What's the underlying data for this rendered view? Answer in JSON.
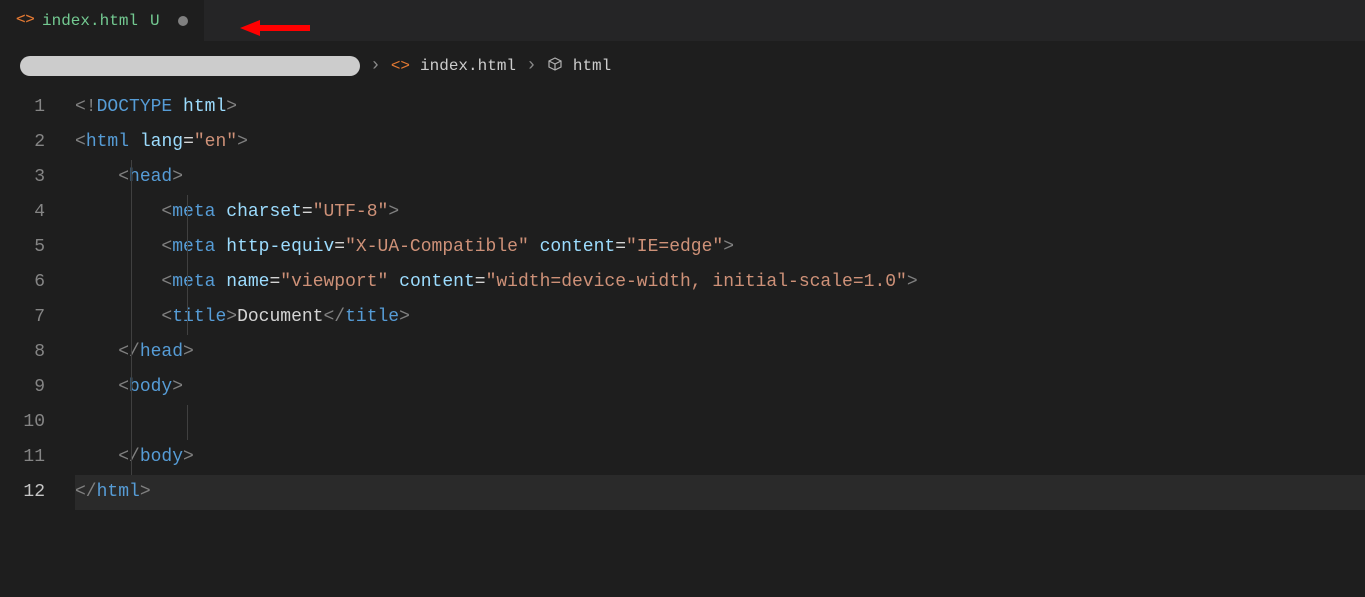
{
  "tab": {
    "filename": "index.html",
    "status": "U"
  },
  "breadcrumb": {
    "file": "index.html",
    "symbol": "html"
  },
  "gutter": {
    "lines": [
      "1",
      "2",
      "3",
      "4",
      "5",
      "6",
      "7",
      "8",
      "9",
      "10",
      "11",
      "12"
    ],
    "current": 12
  },
  "code": {
    "l1": {
      "p1": "<!",
      "p2": "DOCTYPE",
      "p3": " ",
      "p4": "html",
      "p5": ">"
    },
    "l2": {
      "p1": "<",
      "p2": "html",
      "p3": " ",
      "p4": "lang",
      "p5": "=",
      "p6": "\"en\"",
      "p7": ">"
    },
    "l3": {
      "p1": "    ",
      "p2": "<",
      "p3": "head",
      "p4": ">"
    },
    "l4": {
      "p1": "        ",
      "p2": "<",
      "p3": "meta",
      "p4": " ",
      "p5": "charset",
      "p6": "=",
      "p7": "\"UTF-8\"",
      "p8": ">"
    },
    "l5": {
      "p1": "        ",
      "p2": "<",
      "p3": "meta",
      "p4": " ",
      "p5": "http-equiv",
      "p6": "=",
      "p7": "\"X-UA-Compatible\"",
      "p8": " ",
      "p9": "content",
      "p10": "=",
      "p11": "\"IE=edge\"",
      "p12": ">"
    },
    "l6": {
      "p1": "        ",
      "p2": "<",
      "p3": "meta",
      "p4": " ",
      "p5": "name",
      "p6": "=",
      "p7": "\"viewport\"",
      "p8": " ",
      "p9": "content",
      "p10": "=",
      "p11": "\"width=device-width, initial-scale=1.0\"",
      "p12": ">"
    },
    "l7": {
      "p1": "        ",
      "p2": "<",
      "p3": "title",
      "p4": ">",
      "p5": "Document",
      "p6": "</",
      "p7": "title",
      "p8": ">"
    },
    "l8": {
      "p1": "    ",
      "p2": "</",
      "p3": "head",
      "p4": ">"
    },
    "l9": {
      "p1": "    ",
      "p2": "<",
      "p3": "body",
      "p4": ">"
    },
    "l10": {
      "p1": "        "
    },
    "l11": {
      "p1": "    ",
      "p2": "</",
      "p3": "body",
      "p4": ">"
    },
    "l12": {
      "p1": "</",
      "p2": "html",
      "p3": ">"
    }
  }
}
